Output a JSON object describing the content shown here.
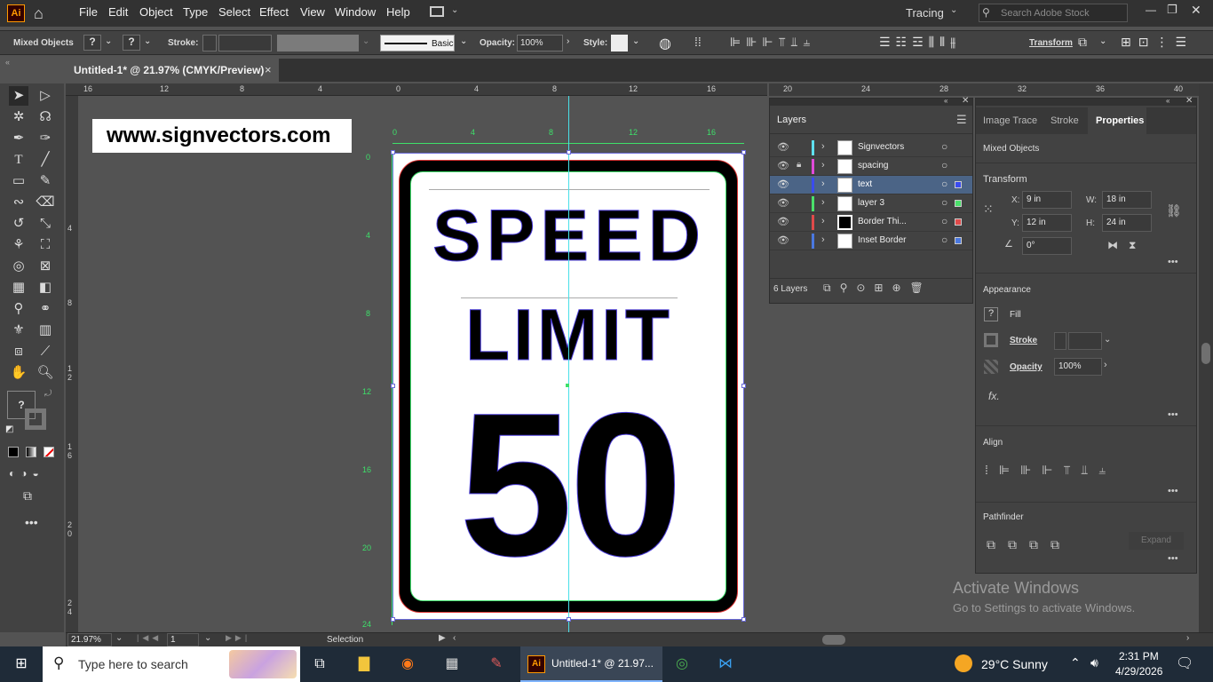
{
  "app": {
    "logo": "Ai",
    "workspace": "Tracing",
    "search_placeholder": "Search Adobe Stock"
  },
  "menu": [
    "File",
    "Edit",
    "Object",
    "Type",
    "Select",
    "Effect",
    "View",
    "Window",
    "Help"
  ],
  "control_bar": {
    "selection_label": "Mixed Objects",
    "stroke_label": "Stroke:",
    "brush_label": "Basic",
    "opacity_label": "Opacity:",
    "opacity_value": "100%",
    "style_label": "Style:",
    "transform_label": "Transform",
    "unknown": "?"
  },
  "document_tab": {
    "title": "Untitled-1* @ 21.97% (CMYK/Preview)",
    "close": "×"
  },
  "ruler_top": [
    "16",
    "12",
    "8",
    "4",
    "0",
    "4",
    "8",
    "12",
    "16",
    "20",
    "24",
    "28",
    "32",
    "36",
    "40"
  ],
  "artboard_ruler_top": [
    "0",
    "4",
    "8",
    "12",
    "16"
  ],
  "artboard_ruler_left": [
    "0",
    "4",
    "8",
    "12",
    "16",
    "20",
    "24"
  ],
  "ruler_left": [
    "4",
    "8",
    "1 2",
    "1 6",
    "2 0",
    "2 4"
  ],
  "watermark": "www.signvectors.com",
  "sign": {
    "line1": "SPEED",
    "line2": "LIMIT",
    "number": "50"
  },
  "layers_panel": {
    "title": "Layers",
    "count": "6 Layers",
    "layers": [
      {
        "name": "Signvectors",
        "color": "#5ee0f0",
        "selected": false,
        "locked": false
      },
      {
        "name": "spacing",
        "color": "#e04ad8",
        "selected": false,
        "locked": true
      },
      {
        "name": "text",
        "color": "#3a4cf0",
        "selected": true,
        "locked": false
      },
      {
        "name": "layer 3",
        "color": "#4ae06a",
        "selected": false,
        "locked": false
      },
      {
        "name": "Border Thi...",
        "color": "#e04a4a",
        "selected": false,
        "locked": false
      },
      {
        "name": "Inset Border",
        "color": "#4a78e0",
        "selected": false,
        "locked": false
      }
    ]
  },
  "properties_panel": {
    "tabs": [
      "Image Trace",
      "Stroke",
      "Properties"
    ],
    "selection": "Mixed Objects",
    "transform": {
      "title": "Transform",
      "x_label": "X:",
      "x": "9 in",
      "y_label": "Y:",
      "y": "12 in",
      "w_label": "W:",
      "w": "18 in",
      "h_label": "H:",
      "h": "24 in",
      "angle": "0°"
    },
    "appearance": {
      "title": "Appearance",
      "fill": "Fill",
      "stroke": "Stroke",
      "opacity": "Opacity",
      "opacity_value": "100%",
      "fx": "fx."
    },
    "align": {
      "title": "Align"
    },
    "pathfinder": {
      "title": "Pathfinder",
      "expand": "Expand"
    }
  },
  "status": {
    "zoom": "21.97%",
    "page": "1",
    "tool": "Selection"
  },
  "activation": {
    "line1": "Activate Windows",
    "line2": "Go to Settings to activate Windows."
  },
  "taskbar": {
    "search_placeholder": "Type here to search",
    "app_title": "Untitled-1* @ 21.97...",
    "weather": "29°C  Sunny",
    "time": "2:31 PM",
    "date": "4/29/2026"
  }
}
